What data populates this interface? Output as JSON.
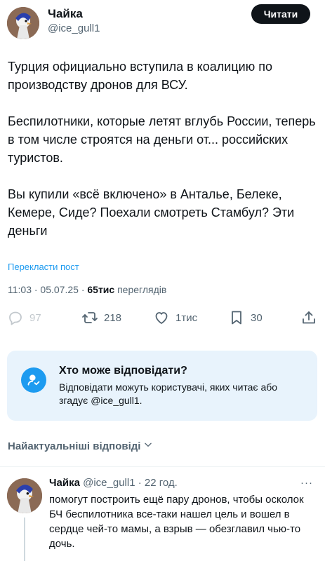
{
  "header": {
    "name": "Чайка",
    "handle": "@ice_gull1",
    "follow_label": "Читати"
  },
  "tweet": {
    "paragraphs": [
      "Турция официально вступила в коалицию по производству дронов для ВСУ.",
      "Беспилотники, которые летят вглубь России, теперь в том числе строятся на деньги от... российских туристов.",
      "Вы купили «всё включено» в Анталье, Белеке, Кемере, Сиде? Поехали смотреть Стамбул? Эти деньги"
    ],
    "translate_label": "Перекласти пост",
    "time": "11:03 · 05.07.25 · ",
    "views_count": "65тис",
    "views_label": " переглядів"
  },
  "actions": {
    "replies": "97",
    "retweets": "218",
    "likes": "1тис",
    "bookmarks": "30"
  },
  "reply_settings": {
    "title": "Хто може відповідати?",
    "description": "Відповідати можуть користувачі, яких читає або згадує @ice_gull1."
  },
  "sort": {
    "label": "Найактуальніші відповіді"
  },
  "comment": {
    "name": "Чайка",
    "handle": "@ice_gull1",
    "time": " · 22 год.",
    "more": "···",
    "text": "помогут построить ещё пару дронов, чтобы осколок БЧ беспилотника все-таки нашел цель и вошел в сердце чей-то мамы, а взрыв — обезглавил чью-то дочь."
  },
  "colors": {
    "accent": "#1d9bf0",
    "text_primary": "#0f1419",
    "text_secondary": "#536471",
    "reply_box_bg": "#e8f3fc"
  },
  "icons": {
    "reply": "reply-icon",
    "retweet": "retweet-icon",
    "like": "heart-icon",
    "bookmark": "bookmark-icon",
    "share": "share-icon",
    "reply_settings": "user-check-icon",
    "sort": "chevron-down-icon"
  }
}
